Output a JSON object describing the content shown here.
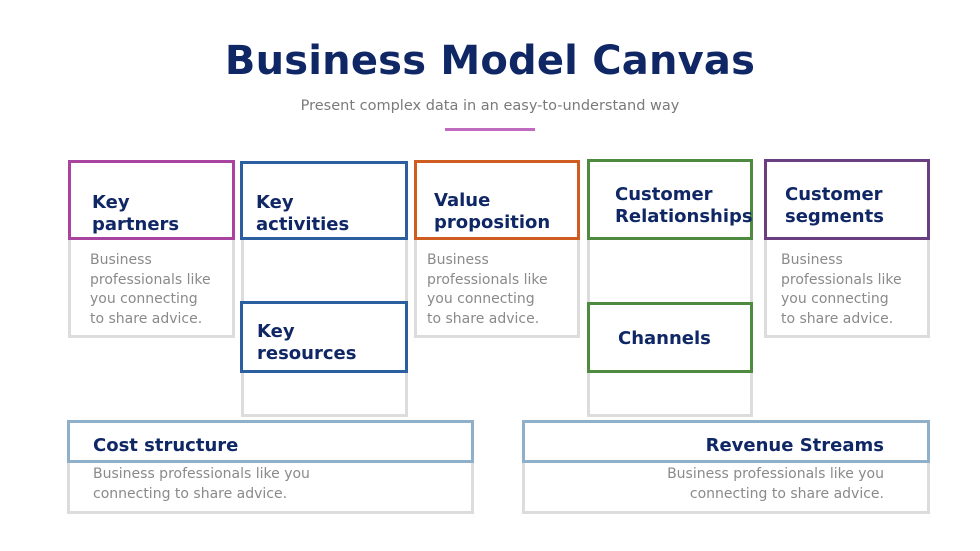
{
  "header": {
    "title": "Business Model Canvas",
    "subtitle": "Present complex data in an easy-to-understand way",
    "accent_color": "#c06bbd",
    "title_color": "#102766"
  },
  "blocks": {
    "key_partners": {
      "title_line1": "Key",
      "title_line2": "partners",
      "description_lines": [
        "Business",
        "professionals like",
        "you connecting",
        "to share advice."
      ],
      "border_color": "#a8449f"
    },
    "key_activities": {
      "title_line1": "Key",
      "title_line2": "activities",
      "border_color": "#2c5fa0"
    },
    "key_resources": {
      "title_line1": "Key",
      "title_line2": "resources",
      "border_color": "#2c5fa0"
    },
    "value_proposition": {
      "title_line1": "Value",
      "title_line2": "proposition",
      "description_lines": [
        "Business",
        "professionals like",
        "you connecting",
        "to share advice."
      ],
      "border_color": "#cf5d22"
    },
    "customer_relationships": {
      "title_line1": "Customer",
      "title_line2": "Relationships",
      "border_color": "#4e8a3f"
    },
    "channels": {
      "title": "Channels",
      "border_color": "#4e8a3f"
    },
    "customer_segments": {
      "title_line1": "Customer",
      "title_line2": "segments",
      "description_lines": [
        "Business",
        "professionals like",
        "you connecting",
        "to share advice."
      ],
      "border_color": "#6b3f7f"
    },
    "cost_structure": {
      "title": "Cost structure",
      "description_lines": [
        "Business professionals like you",
        "connecting to share advice."
      ],
      "border_color": "#8fb0c8"
    },
    "revenue_streams": {
      "title": "Revenue Streams",
      "description_lines": [
        "Business professionals like you",
        "connecting to share advice."
      ],
      "border_color": "#8fb0c8"
    }
  }
}
